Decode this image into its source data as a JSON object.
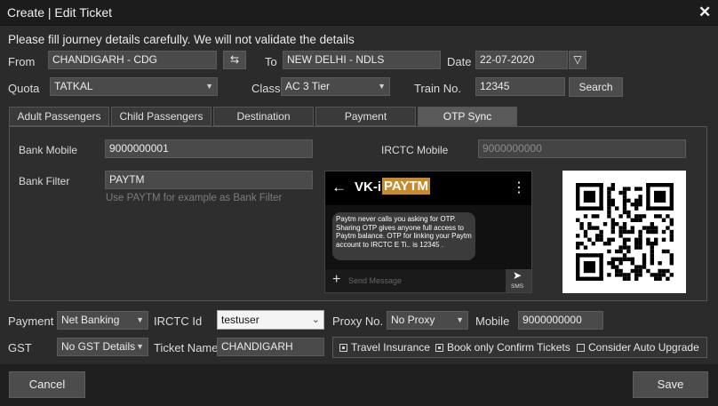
{
  "window": {
    "title": "Create | Edit Ticket",
    "close_glyph": "✕"
  },
  "notice": "Please fill journey details carefully. We will not validate the details",
  "journey": {
    "from_label": "From",
    "from_value": "CHANDIGARH - CDG",
    "swap_glyph": "⇆",
    "to_label": "To",
    "to_value": "NEW DELHI - NDLS",
    "date_label": "Date",
    "date_value": "22-07-2020",
    "date_glyph": "▽",
    "quota_label": "Quota",
    "quota_value": "TATKAL",
    "class_label": "Class",
    "class_value": "AC 3 Tier",
    "train_label": "Train No.",
    "train_value": "12345",
    "search_label": "Search"
  },
  "tabs": [
    {
      "label": "Adult Passengers"
    },
    {
      "label": "Child Passengers"
    },
    {
      "label": "Destination"
    },
    {
      "label": "Payment"
    },
    {
      "label": "OTP Sync"
    }
  ],
  "otp": {
    "bank_mobile_label": "Bank Mobile",
    "bank_mobile_value": "9000000001",
    "irctc_mobile_label": "IRCTC Mobile",
    "irctc_mobile_placeholder": "9000000000",
    "bank_filter_label": "Bank Filter",
    "bank_filter_value": "PAYTM",
    "bank_filter_hint": "Use PAYTM for example as Bank Filter",
    "sms": {
      "back_glyph": "←",
      "sender_prefix": "VK-i",
      "sender_highlight": "PAYTM",
      "menu_glyph": "⋮",
      "message": "Paytm never calls you asking for OTP. Sharing OTP gives anyone full access to Paytm balance. OTP for linking your Paytm account to IRCTC E Ti.. is 12345 .",
      "plus_glyph": "+",
      "input_placeholder": "Send Message",
      "send_label": "SMS"
    }
  },
  "footer": {
    "payment_label": "Payment",
    "payment_value": "Net Banking",
    "irctc_id_label": "IRCTC Id",
    "irctc_id_value": "testuser",
    "proxy_label": "Proxy No.",
    "proxy_value": "No Proxy",
    "mobile_label": "Mobile",
    "mobile_value": "9000000000",
    "gst_label": "GST",
    "gst_value": "No GST Details",
    "ticket_name_label": "Ticket Name",
    "ticket_name_value": "CHANDIGARH",
    "travel_insurance_label": "Travel Insurance",
    "travel_insurance_checked": true,
    "confirm_only_label": "Book only Confirm Tickets",
    "confirm_only_checked": true,
    "auto_upgrade_label": "Consider Auto Upgrade",
    "auto_upgrade_checked": false
  },
  "actions": {
    "cancel_label": "Cancel",
    "save_label": "Save"
  },
  "colors": {
    "background": "#2b2b2b",
    "field": "#4a4a4a",
    "sms_highlight": "#c98a2b",
    "active_tab": "#5a5a5a"
  }
}
